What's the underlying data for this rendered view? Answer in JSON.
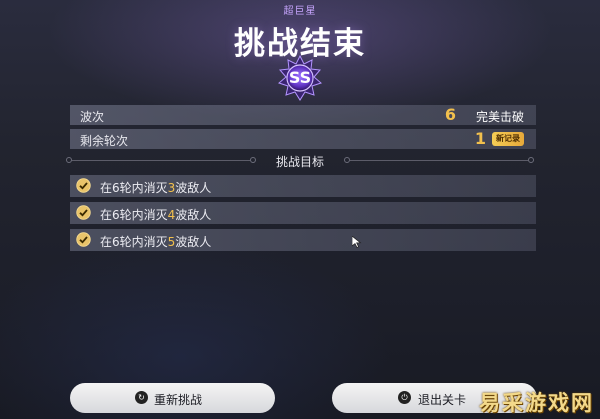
{
  "header": {
    "subtitle": "超巨星",
    "title": "挑战结束",
    "rank": "SS"
  },
  "stats": [
    {
      "label": "波次",
      "value": "6",
      "suffix": "完美击破"
    },
    {
      "label": "剩余轮次",
      "value": "1",
      "badge": "新记录"
    }
  ],
  "objectives": {
    "title": "挑战目标",
    "items": [
      {
        "prefix": "在6轮内消灭",
        "count": "3",
        "suffix": "波敌人",
        "completed": true
      },
      {
        "prefix": "在6轮内消灭",
        "count": "4",
        "suffix": "波敌人",
        "completed": true
      },
      {
        "prefix": "在6轮内消灭",
        "count": "5",
        "suffix": "波敌人",
        "completed": true
      }
    ]
  },
  "buttons": {
    "retry_label": "重新挑战",
    "exit_label": "退出关卡"
  },
  "watermark": "易采游戏网",
  "colors": {
    "accent_gold": "#f2c04d",
    "rank_purple": "#8a5bff",
    "subtitle_purple": "#c8a6ff"
  }
}
